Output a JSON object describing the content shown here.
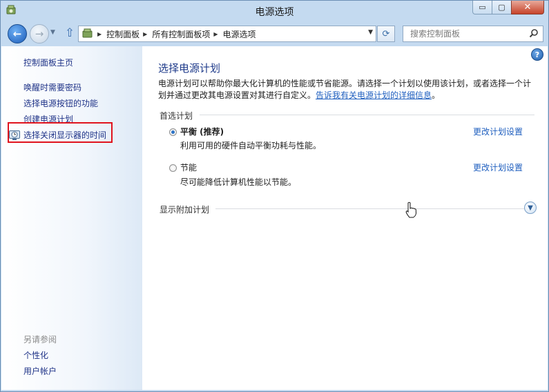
{
  "window": {
    "title": "电源选项",
    "controls": {
      "minimize": "▭",
      "maximize": "▢",
      "close": "✕"
    }
  },
  "nav": {
    "back_icon": "back-arrow-icon",
    "forward_icon": "forward-arrow-icon",
    "up_icon": "up-arrow-icon",
    "breadcrumbs": [
      "控制面板",
      "所有控制面板项",
      "电源选项"
    ],
    "search_placeholder": "搜索控制面板"
  },
  "sidebar": {
    "home": "控制面板主页",
    "items": [
      {
        "label": "唤醒时需要密码"
      },
      {
        "label": "选择电源按钮的功能"
      },
      {
        "label": "创建电源计划"
      },
      {
        "label": "选择关闭显示器的时间"
      }
    ],
    "see_also_title": "另请参阅",
    "see_also": [
      {
        "label": "个性化"
      },
      {
        "label": "用户帐户"
      }
    ]
  },
  "main": {
    "title": "选择电源计划",
    "description": "电源计划可以帮助你最大化计算机的性能或节省能源。请选择一个计划以使用该计划，或者选择一个计划并通过更改其电源设置对其进行自定义。",
    "description_link": "告诉我有关电源计划的详细信息",
    "description_end": "。",
    "preferred_label": "首选计划",
    "plans": [
      {
        "name": "平衡 (推荐)",
        "desc": "利用可用的硬件自动平衡功耗与性能。",
        "selected": true,
        "link": "更改计划设置"
      },
      {
        "name": "节能",
        "desc": "尽可能降低计算机性能以节能。",
        "selected": false,
        "link": "更改计划设置"
      }
    ],
    "show_additional": "显示附加计划"
  },
  "colors": {
    "highlight_border": "#e0131d",
    "link": "#1f5fbf",
    "title": "#1e3a8a"
  }
}
